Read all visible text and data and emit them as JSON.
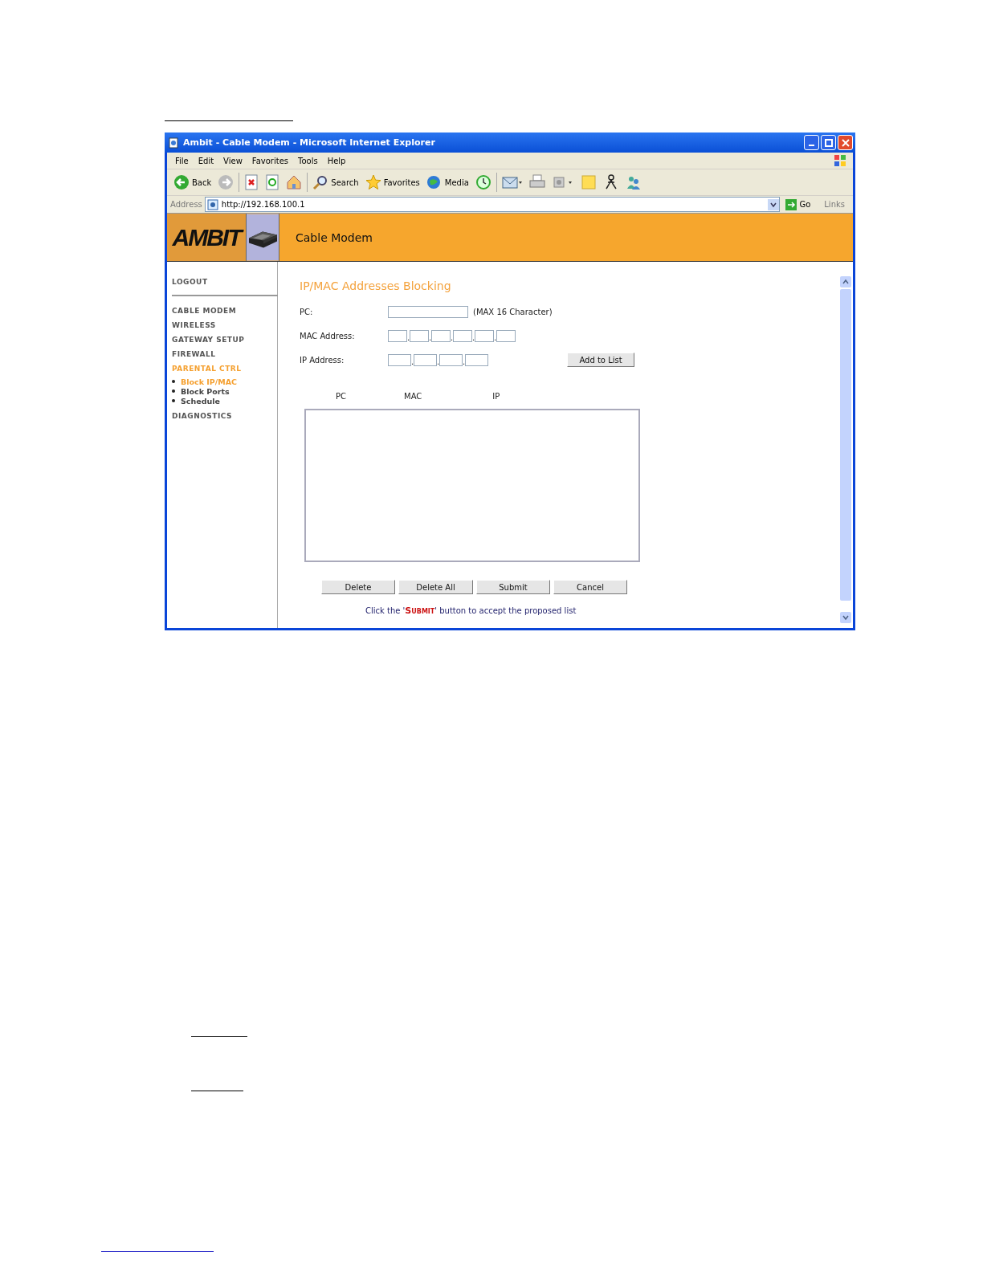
{
  "window": {
    "title": "Ambit - Cable Modem - Microsoft Internet Explorer"
  },
  "menu": [
    "File",
    "Edit",
    "View",
    "Favorites",
    "Tools",
    "Help"
  ],
  "toolbar": [
    {
      "kind": "back",
      "label": "Back"
    },
    {
      "kind": "forward"
    },
    {
      "kind": "stop"
    },
    {
      "kind": "refresh"
    },
    {
      "kind": "home"
    },
    {
      "kind": "search",
      "label": "Search"
    },
    {
      "kind": "favorites",
      "label": "Favorites"
    },
    {
      "kind": "media",
      "label": "Media"
    },
    {
      "kind": "history"
    },
    {
      "kind": "mail"
    },
    {
      "kind": "print"
    },
    {
      "kind": "edit"
    },
    {
      "kind": "note"
    },
    {
      "kind": "messenger"
    },
    {
      "kind": "people"
    }
  ],
  "address": {
    "label": "Address",
    "value": "http://192.168.100.1",
    "go": "Go",
    "links": "Links"
  },
  "header": {
    "logo": "AMBIT",
    "title": "Cable Modem"
  },
  "sidebar": {
    "logout": "LOGOUT",
    "items": [
      {
        "label": "CABLE MODEM",
        "selected": false
      },
      {
        "label": "WIRELESS",
        "selected": false
      },
      {
        "label": "GATEWAY SETUP",
        "selected": false
      },
      {
        "label": "FIREWALL",
        "selected": false
      },
      {
        "label": "PARENTAL CTRL",
        "selected": true,
        "children": [
          {
            "label": "Block IP/MAC",
            "selected": true
          },
          {
            "label": "Block Ports",
            "selected": false
          },
          {
            "label": "Schedule",
            "selected": false
          }
        ]
      },
      {
        "label": "DIAGNOSTICS",
        "selected": false
      }
    ]
  },
  "form": {
    "title": "IP/MAC Addresses Blocking",
    "pc_label": "PC:",
    "pc_hint": "(MAX 16 Character)",
    "mac_label": "MAC Address:",
    "ip_label": "IP Address:",
    "separator": ".",
    "add_button": "Add to List"
  },
  "list": {
    "columns": [
      "PC",
      "MAC",
      "IP"
    ]
  },
  "buttons": [
    "Delete",
    "Delete All",
    "Submit",
    "Cancel"
  ],
  "note": "Click the '**Submit**' button to accept the proposed list"
}
